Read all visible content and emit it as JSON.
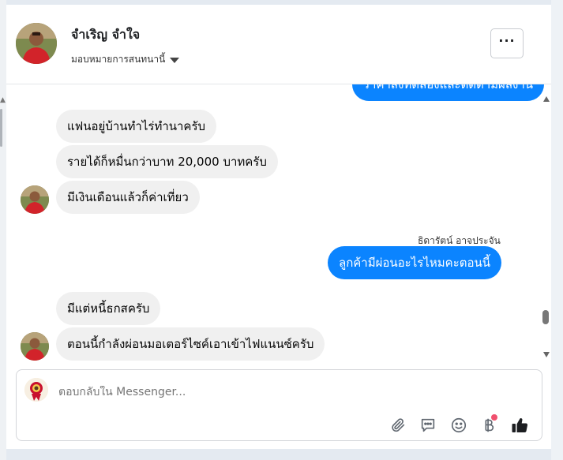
{
  "header": {
    "contact_name": "จำเริญ จำใจ",
    "assign_label": "มอบหมายการสนทนานี้",
    "more_label": "···"
  },
  "messages": [
    {
      "direction": "out",
      "text": "ราคาส่งทดลองและติดตามผลงาน",
      "partial": true
    },
    {
      "direction": "in",
      "text": "แฟนอยู่บ้านทำไร่ทำนาครับ"
    },
    {
      "direction": "in",
      "text": "รายได้ก็หมื่นกว่าบาท 20,000 บาทครับ"
    },
    {
      "direction": "in",
      "text": "มีเงินเดือนแล้วก็ค่าเที่ยว"
    },
    {
      "direction": "out",
      "sender": "ธิดารัตน์ อาจประจัน",
      "text": "ลูกค้ามีผ่อนอะไรไหมคะตอนนี้"
    },
    {
      "direction": "in",
      "text": "มีแต่หนี้ธกสครับ"
    },
    {
      "direction": "in",
      "text": "ตอนนี้กำลังผ่อนมอเตอร์ไซค์เอาเข้าไฟแนนซ์ครับ"
    }
  ],
  "composer": {
    "placeholder": "ตอบกลับใน Messenger...",
    "icons": [
      "paperclip-icon",
      "saved-reply-icon",
      "emoji-icon",
      "baht-payment-icon",
      "thumbs-up-icon"
    ]
  },
  "colors": {
    "outgoing_bubble": "#0b84ff",
    "incoming_bubble": "#f0f0f0",
    "notification_dot": "#f0506e"
  }
}
